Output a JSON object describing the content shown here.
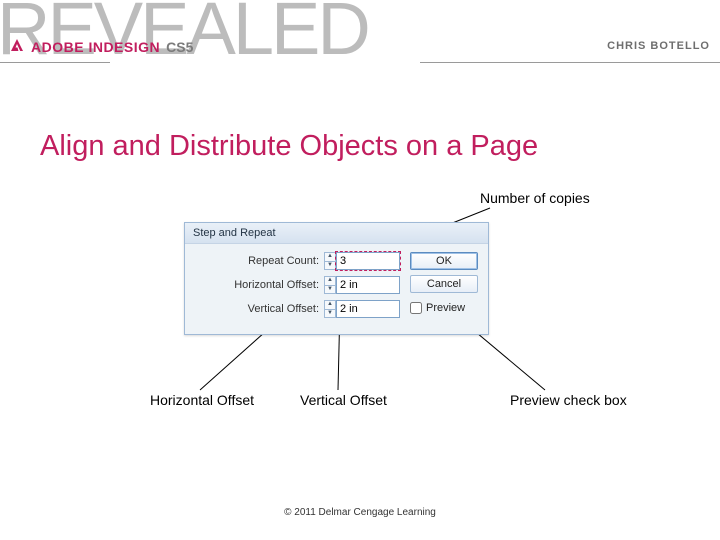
{
  "banner": {
    "revealed": "REVEALED",
    "brand": "ADOBE INDESIGN",
    "version": "CS5",
    "author": "CHRIS BOTELLO"
  },
  "title": "Align and Distribute Objects on a Page",
  "callouts": {
    "copies": "Number of copies",
    "hoffset": "Horizontal Offset",
    "voffset": "Vertical Offset",
    "preview": "Preview check box"
  },
  "dialog": {
    "title": "Step and Repeat",
    "rows": {
      "repeat_label": "Repeat Count:",
      "repeat_value": "3",
      "hoffset_label": "Horizontal Offset:",
      "hoffset_value": "2 in",
      "voffset_label": "Vertical Offset:",
      "voffset_value": "2 in"
    },
    "buttons": {
      "ok": "OK",
      "cancel": "Cancel",
      "preview": "Preview"
    }
  },
  "footer": "© 2011 Delmar Cengage Learning"
}
